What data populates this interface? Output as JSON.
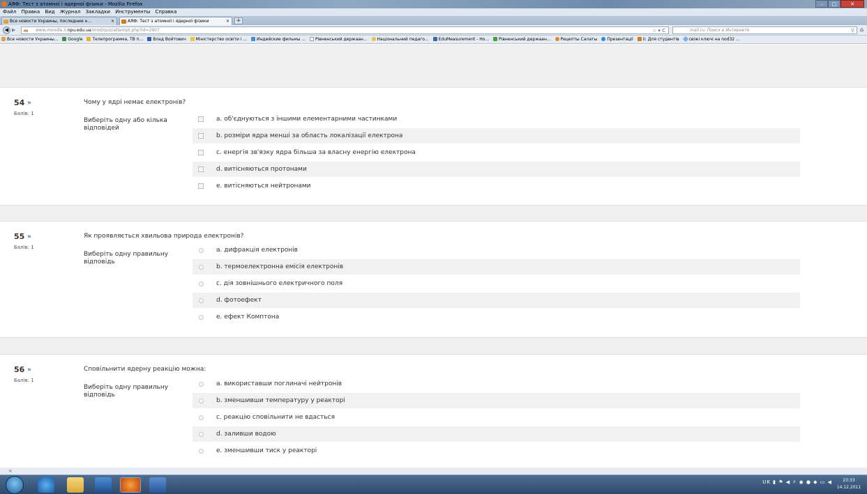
{
  "window": {
    "title": "АЯФ: Тест з атомної і ядерної фізики - Mozilla Firefox"
  },
  "menu": [
    "Файл",
    "Правка",
    "Вид",
    "Журнал",
    "Закладки",
    "Инструменты",
    "Справка"
  ],
  "tabs": [
    {
      "label": "Все новости Украины, последние н..."
    },
    {
      "label": "АЯФ: Тест з атомної і ядерної фізики"
    }
  ],
  "address": {
    "prefix": "www.moodle.",
    "host_pre": "ii.",
    "host": "npu.edu.ua",
    "path": "/mod/quiz/attempt.php?id=2907"
  },
  "search": {
    "placeholder": "mail.ru: Поиск в Интернете"
  },
  "bookmarks": [
    "Все новости Украины...",
    "Google",
    "Телепрограмма, ТВ п...",
    "Влад Войтович",
    "Міністерство освіти і ...",
    "Индийские фильмы ...",
    "Рівненський держаан...",
    "Національний педаго...",
    "EduMeasurement - Но...",
    "Рівненський держаан...",
    "Рецепты Салаты",
    "Презентації",
    "ii: Для студентів",
    "свіжі ключі на nod32 ..."
  ],
  "questions": [
    {
      "number": "54",
      "score": "Балів: 1",
      "text": "Чому у ядрі немає електронів?",
      "prompt": "Виберіть одну або кілька відповідей",
      "type": "checkbox",
      "answers": [
        "a. об'єднуються з іншими елементарними частинками",
        "b. розміри ядра менші за область локалізації електрона",
        "c. енергія зв'язку ядра більша за власну енергію електрона",
        "d. витісняються протонами",
        "e. витісняються нейтронами"
      ]
    },
    {
      "number": "55",
      "score": "Балів: 1",
      "text": "Як проявляється хвильова природа електронів?",
      "prompt": "Виберіть одну правильну відповідь",
      "type": "radio",
      "answers": [
        "a. дифракція електронів",
        "b. термоелектронна емісія електронів",
        "c. дія зовнішнього електричного поля",
        "d. фотоефект",
        "e. ефект Комптона"
      ]
    },
    {
      "number": "56",
      "score": "Балів: 1",
      "text": "Сповільнити ядерну реакцію можна:",
      "prompt": "Виберіть одну правильну відповідь",
      "type": "radio",
      "answers": [
        "a. використавши поглиначі нейтронів",
        "b. зменшивши температуру у реакторі",
        "c. реакцію сповільнити не вдасться",
        "d. заливши водою",
        "e. зменшивши тиск у реакторі"
      ]
    }
  ],
  "statusbar": {
    "text": "×"
  },
  "tray": {
    "lang": "UK",
    "time": "23:33",
    "date": "14.12.2011"
  },
  "colors": {
    "accent": "#8aa7c6",
    "row_alt": "#f1f1f1",
    "taskbar": "#2e4a6b"
  }
}
